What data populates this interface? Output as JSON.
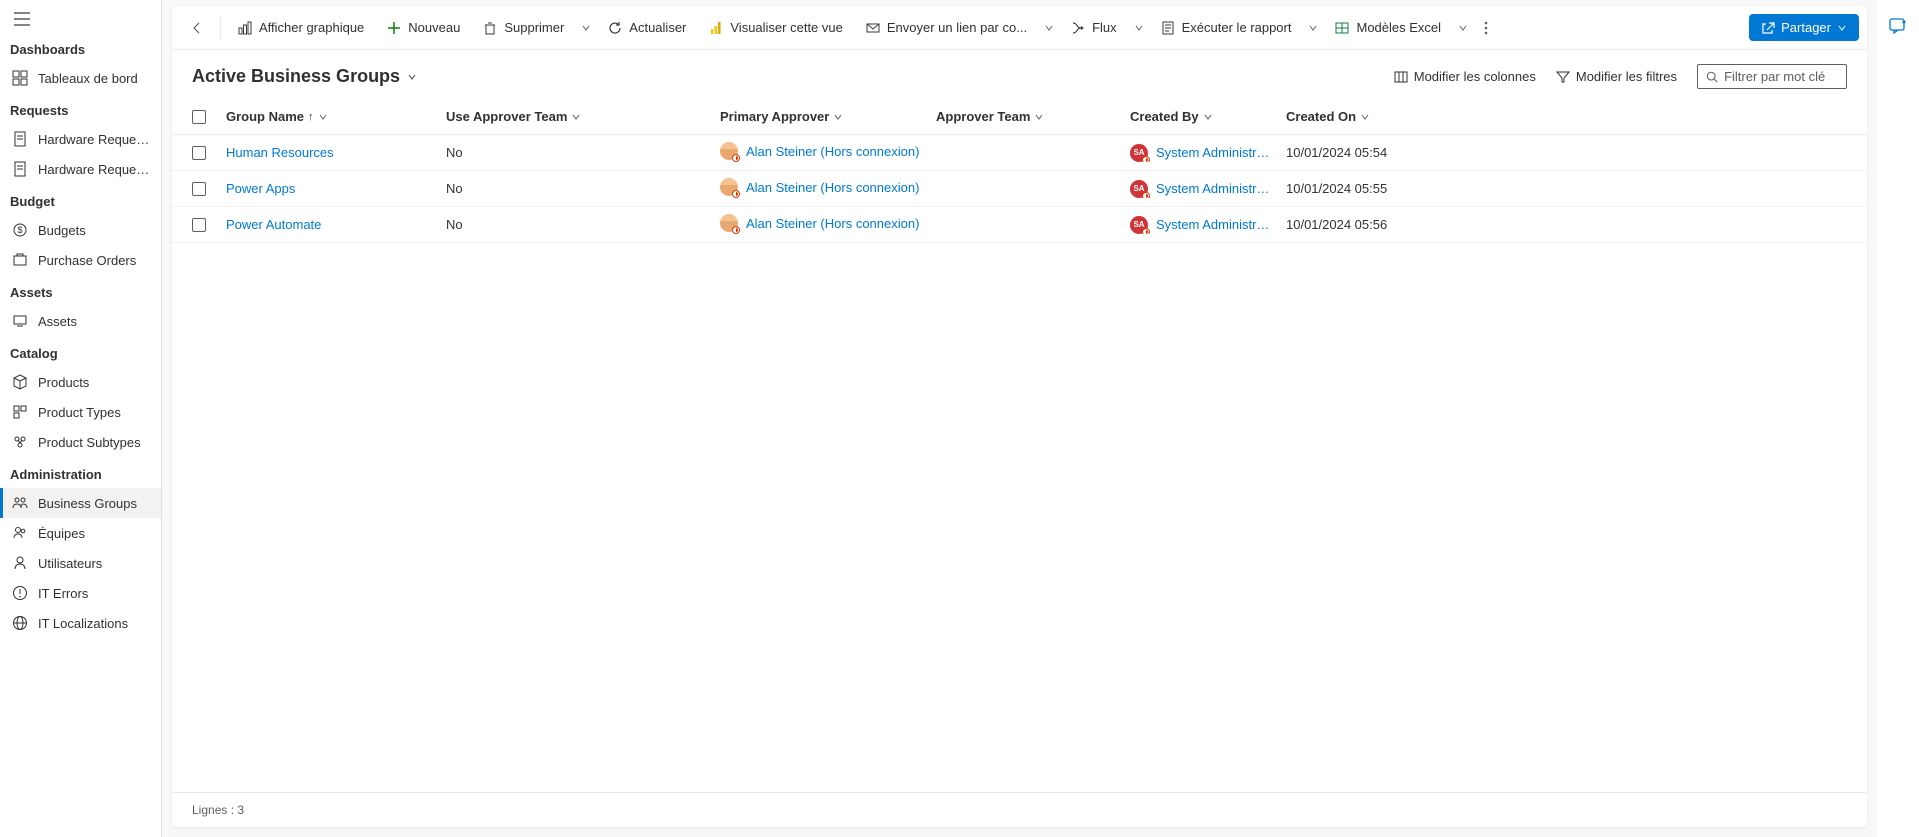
{
  "sidebar": {
    "sections": [
      {
        "title": "Dashboards",
        "items": [
          {
            "icon": "dashboard",
            "label": "Tableaux de bord"
          }
        ]
      },
      {
        "title": "Requests",
        "items": [
          {
            "icon": "request",
            "label": "Hardware Requests"
          },
          {
            "icon": "request",
            "label": "Hardware Reques..."
          }
        ]
      },
      {
        "title": "Budget",
        "items": [
          {
            "icon": "budget",
            "label": "Budgets"
          },
          {
            "icon": "purchase",
            "label": "Purchase Orders"
          }
        ]
      },
      {
        "title": "Assets",
        "items": [
          {
            "icon": "asset",
            "label": "Assets"
          }
        ]
      },
      {
        "title": "Catalog",
        "items": [
          {
            "icon": "product",
            "label": "Products"
          },
          {
            "icon": "product-type",
            "label": "Product Types"
          },
          {
            "icon": "product-subtype",
            "label": "Product Subtypes"
          }
        ]
      },
      {
        "title": "Administration",
        "items": [
          {
            "icon": "group",
            "label": "Business Groups",
            "active": true
          },
          {
            "icon": "team",
            "label": "Équipes"
          },
          {
            "icon": "user",
            "label": "Utilisateurs"
          },
          {
            "icon": "error",
            "label": "IT Errors"
          },
          {
            "icon": "globe",
            "label": "IT Localizations"
          }
        ]
      }
    ]
  },
  "commandBar": {
    "showChart": "Afficher graphique",
    "new": "Nouveau",
    "delete": "Supprimer",
    "refresh": "Actualiser",
    "visualize": "Visualiser cette vue",
    "emailLink": "Envoyer un lien par co...",
    "flow": "Flux",
    "runReport": "Exécuter le rapport",
    "excelTemplates": "Modèles Excel",
    "share": "Partager"
  },
  "view": {
    "title": "Active Business Groups",
    "editColumns": "Modifier les colonnes",
    "editFilters": "Modifier les filtres",
    "filterPlaceholder": "Filtrer par mot clé"
  },
  "grid": {
    "columns": {
      "groupName": "Group Name",
      "useApproverTeam": "Use Approver Team",
      "primaryApprover": "Primary Approver",
      "approverTeam": "Approver Team",
      "createdBy": "Created By",
      "createdOn": "Created On"
    },
    "rows": [
      {
        "groupName": "Human Resources",
        "useApproverTeam": "No",
        "primaryApprover": "Alan Steiner (Hors connexion)",
        "approverTeam": "",
        "createdBy": "System Administrator (A...",
        "createdOn": "10/01/2024 05:54"
      },
      {
        "groupName": "Power Apps",
        "useApproverTeam": "No",
        "primaryApprover": "Alan Steiner (Hors connexion)",
        "approverTeam": "",
        "createdBy": "System Administrator (A...",
        "createdOn": "10/01/2024 05:55"
      },
      {
        "groupName": "Power Automate",
        "useApproverTeam": "No",
        "primaryApprover": "Alan Steiner (Hors connexion)",
        "approverTeam": "",
        "createdBy": "System Administrator (A...",
        "createdOn": "10/01/2024 05:56"
      }
    ],
    "footer": "Lignes : 3"
  },
  "avatarSA": "SA"
}
